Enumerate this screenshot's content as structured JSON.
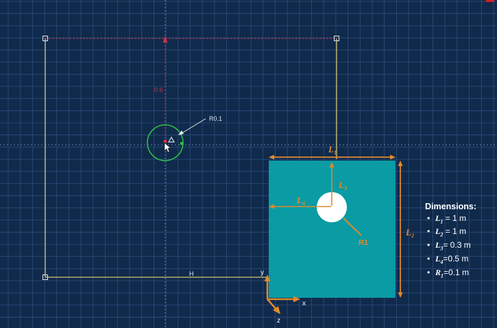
{
  "sketch": {
    "dimension_vertical": "0.6",
    "radius_callout": "R0.1",
    "horizontal_constraint": "H"
  },
  "diagram": {
    "labels": {
      "L1": {
        "main": "L",
        "sub": "1"
      },
      "L2": {
        "main": "L",
        "sub": "2"
      },
      "L3": {
        "main": "L",
        "sub": "3"
      },
      "L4": {
        "main": "L",
        "sub": "4"
      },
      "R1": "R1"
    },
    "axes": {
      "x": "x",
      "y": "y",
      "z": "z"
    },
    "colors": {
      "plate": "#0a9ba4",
      "dimension": "#e08a2c",
      "hole": "#ffffff"
    }
  },
  "dimensions_panel": {
    "title": "Dimensions:",
    "items": [
      {
        "sym": "L",
        "sub": "1",
        "value": " = 1 m"
      },
      {
        "sym": "L",
        "sub": "2",
        "value": " = 1 m"
      },
      {
        "sym": "L",
        "sub": "3",
        "value": "= 0.3 m"
      },
      {
        "sym": "L",
        "sub": "4",
        "value": "=0.5 m"
      },
      {
        "sym": "R",
        "sub": "1",
        "value": "=0.1 m"
      }
    ]
  },
  "colors": {
    "background": "#102a4c",
    "grid": "#2d4e7c",
    "sketch_line": "#d6c270",
    "construction_line": "#c8344a",
    "circle": "#2fbf4a"
  }
}
